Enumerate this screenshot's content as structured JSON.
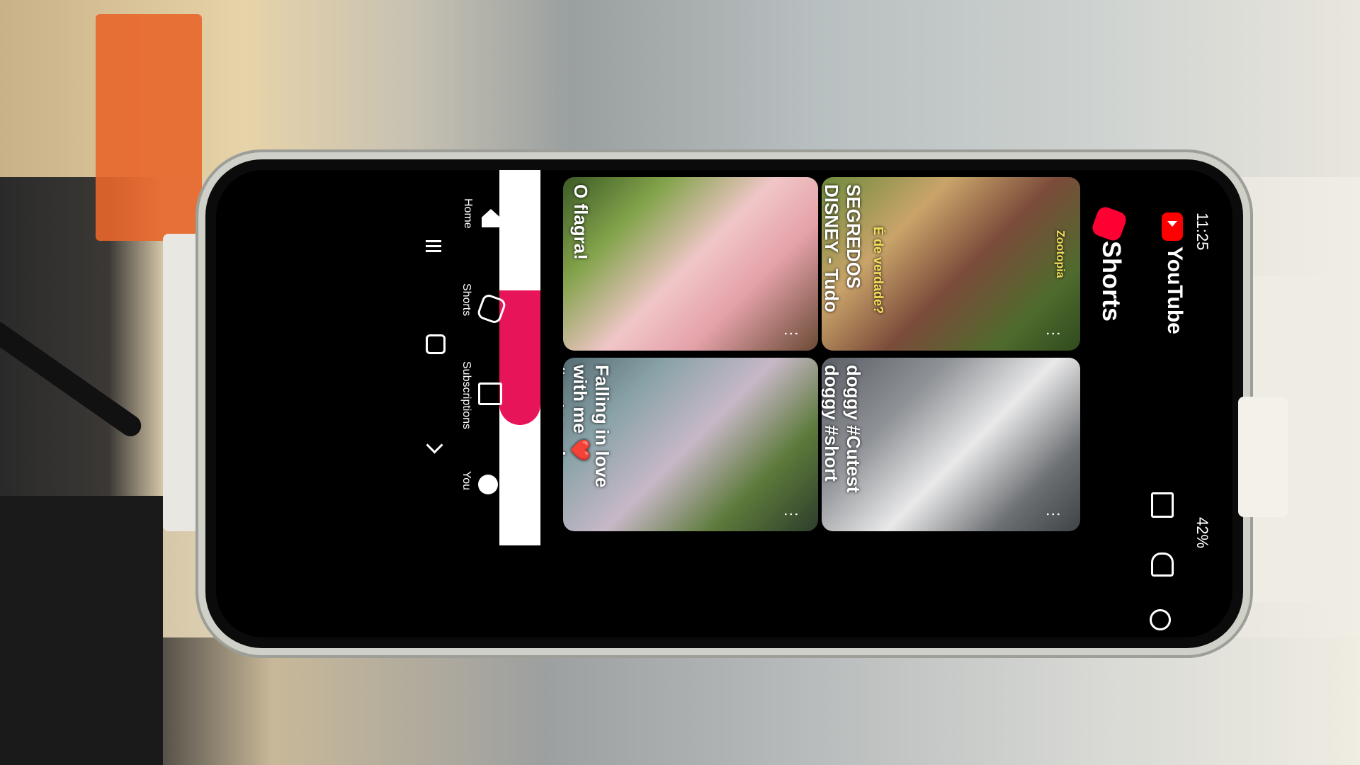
{
  "status_bar": {
    "time": "11:25",
    "battery": "42%"
  },
  "header": {
    "app_name": "YouTube",
    "section_title": "Shorts"
  },
  "shorts": [
    {
      "caption_top": "É de verdade?",
      "caption": "SEGREDOS DISNEY - Tudo sobre o picolé ...",
      "tag": "Zootopia"
    },
    {
      "caption": "doggy #Cutest doggy #short #homepet"
    },
    {
      "caption": "O flagra!"
    },
    {
      "caption": "Falling in love with me ❤️ #motocycle ..."
    }
  ],
  "nav": {
    "home": "Home",
    "shorts": "Shorts",
    "subscriptions": "Subscriptions",
    "you": "You"
  },
  "more_label": "⋮"
}
